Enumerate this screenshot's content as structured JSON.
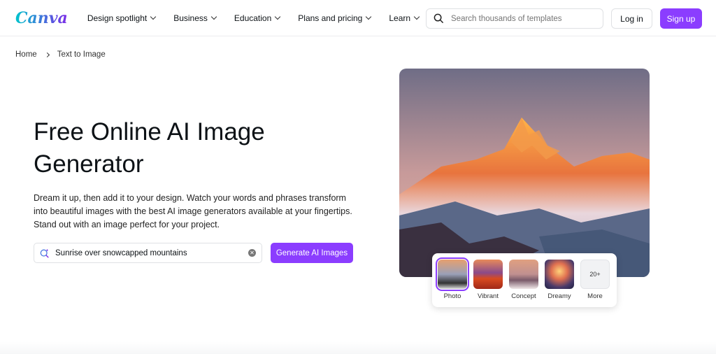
{
  "nav": {
    "logo": "Canva",
    "items": [
      {
        "label": "Design spotlight"
      },
      {
        "label": "Business"
      },
      {
        "label": "Education"
      },
      {
        "label": "Plans and pricing"
      },
      {
        "label": "Learn"
      }
    ],
    "search_placeholder": "Search thousands of templates",
    "login": "Log in",
    "signup": "Sign up",
    "accent": "#8b3dff"
  },
  "breadcrumb": {
    "home": "Home",
    "current": "Text to Image"
  },
  "hero": {
    "title": "Free Online AI Image Generator",
    "description": "Dream it up, then add it to your design. Watch your words and phrases transform into beautiful images with the best AI image generators available at your fingertips. Stand out with an image perfect for your project.",
    "prompt_value": "Sunrise over snowcapped mountains",
    "generate": "Generate AI Images"
  },
  "styles": [
    {
      "label": "Photo",
      "selected": true
    },
    {
      "label": "Vibrant"
    },
    {
      "label": "Concept"
    },
    {
      "label": "Dreamy"
    },
    {
      "label": "More",
      "badge": "20+"
    }
  ]
}
